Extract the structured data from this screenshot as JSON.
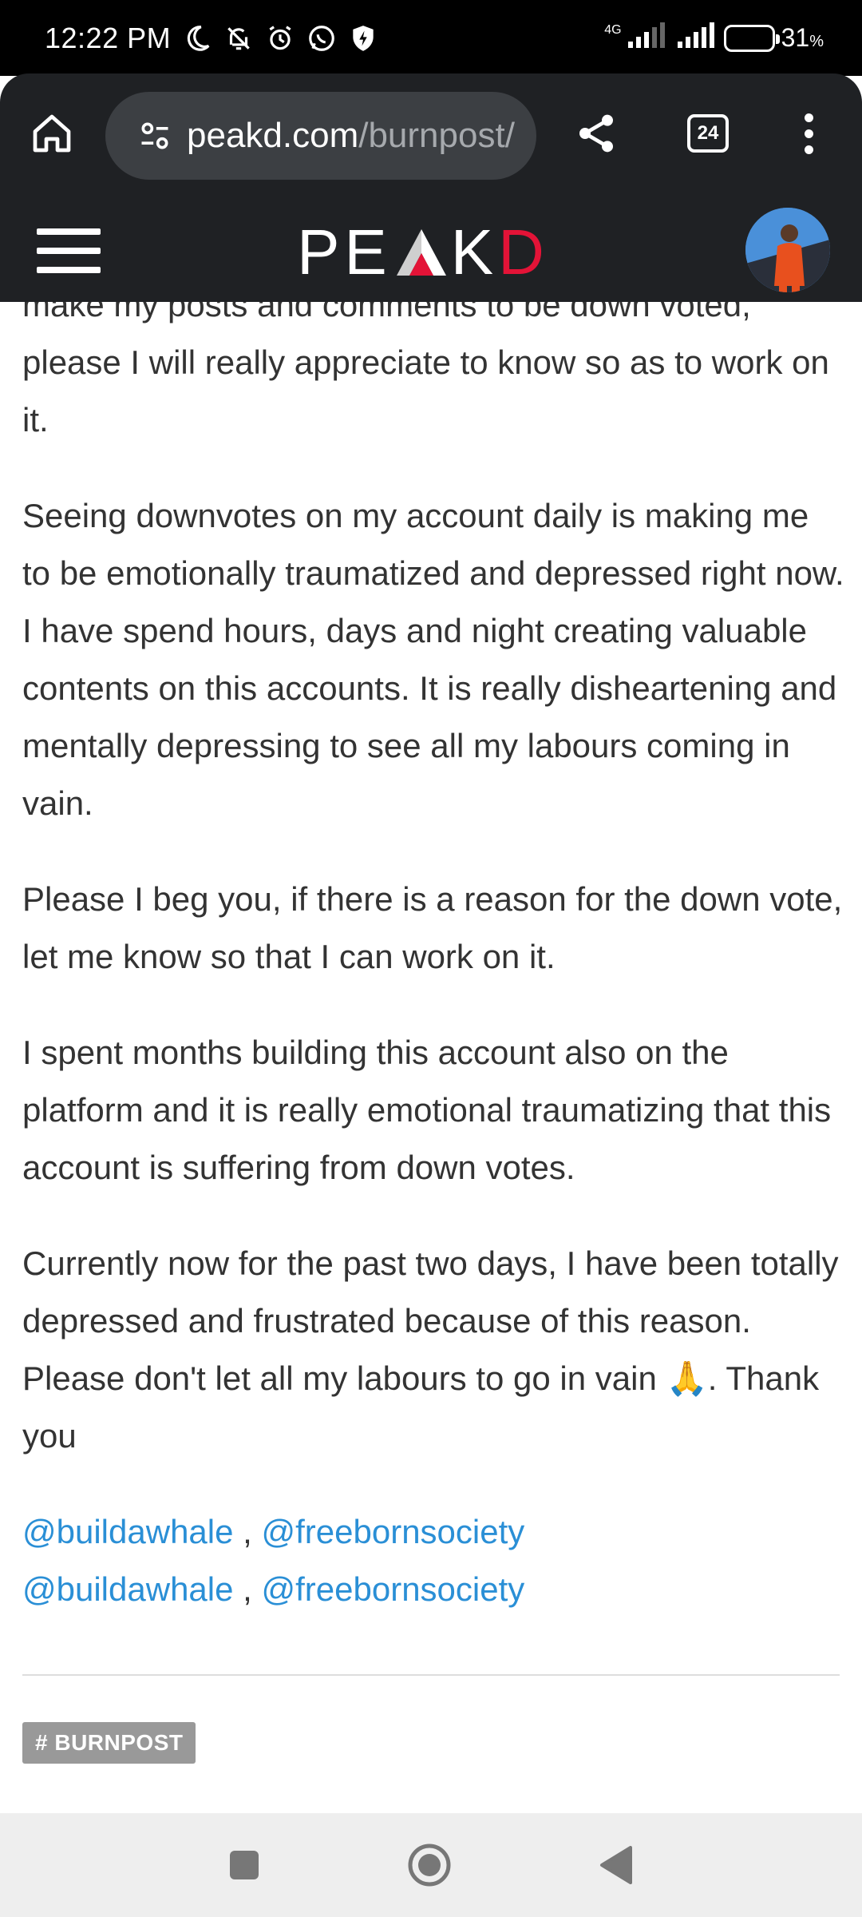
{
  "status": {
    "time": "12:22 PM",
    "network_label": "4G",
    "battery_percent": "31",
    "battery_unit": "%"
  },
  "browser": {
    "url_domain": "peakd.com",
    "url_path": "/burnpost/",
    "tab_count": "24"
  },
  "site": {
    "logo_left": "PE",
    "logo_right_k": "K",
    "logo_right_d": "D"
  },
  "post": {
    "paragraphs": [
      "make my posts and comments to be down voted,",
      "please I will really appreciate to know so as to work on it.",
      "Seeing downvotes on my account daily is making me to be emotionally traumatized and depressed right now. I have spend hours, days and night creating valuable contents on this accounts. It is really disheartening and mentally depressing to see all my labours coming in vain.",
      "Please I beg you, if there is a reason for the down vote, let me know so that I can work on it.",
      "I spent months building this account also on the platform and it is really emotional traumatizing that this account is suffering from down votes.",
      "Currently now for the past two days, I have been totally depressed and frustrated because of this reason. Please don't let all my labours to go in vain 🙏. Thank you"
    ],
    "mentions": [
      {
        "a": "@buildawhale",
        "sep": " , ",
        "b": "@freebornsociety"
      },
      {
        "a": "@buildawhale",
        "sep": " , ",
        "b": "@freebornsociety"
      }
    ],
    "tag": "# BURNPOST"
  },
  "colors": {
    "link": "#2a8fd6",
    "brand_red": "#e31337",
    "header_bg": "#1f2124"
  }
}
